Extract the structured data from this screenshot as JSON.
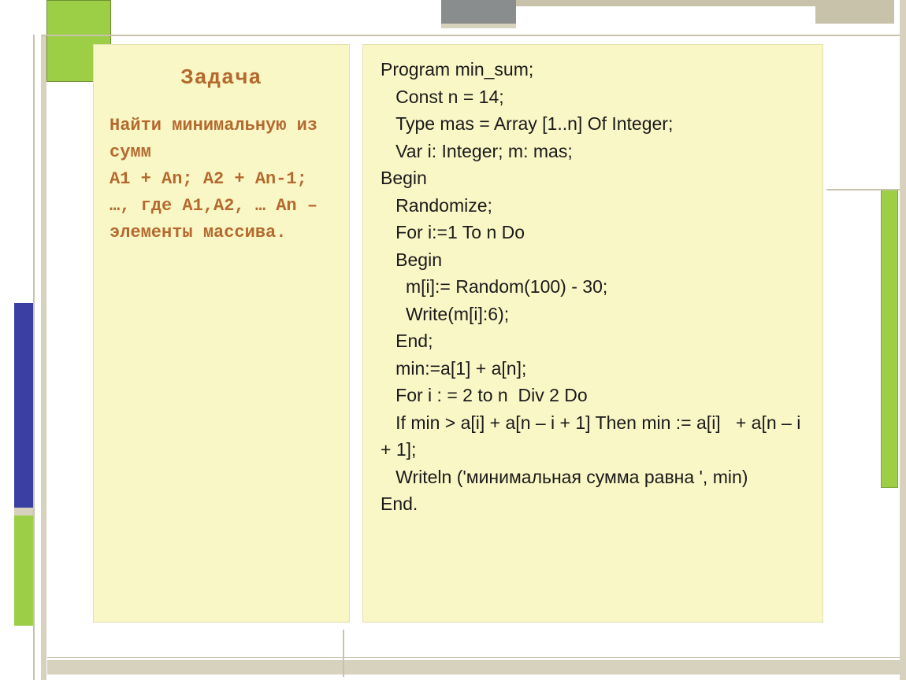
{
  "title": "Задача",
  "task": {
    "line1": "Найти минимальную из сумм",
    "line2": "A1 + An; A2 + An-1; …, где А1,А2, … Аn – элементы массива."
  },
  "code_lines": [
    "Program min_sum;",
    "   Const n = 14;",
    "   Type mas = Array [1..n] Of Integer;",
    "   Var i: Integer; m: mas;",
    "Begin",
    "   Randomize;",
    "   For i:=1 To n Do",
    "   Begin",
    "     m[i]:= Random(100) - 30;",
    "     Write(m[i]:6);",
    "   End;",
    "   min:=a[1] + a[n];",
    "   For i : = 2 to n  Div 2 Do",
    "   If min > a[i] + a[n – i + 1] Then min := a[i]   + a[n – i + 1];",
    "   Writeln ('минимальная сумма равна ', min)",
    "End."
  ]
}
